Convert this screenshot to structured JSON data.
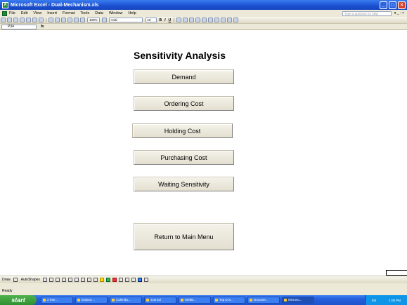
{
  "window": {
    "title": "Microsoft Excel - Dual-Mechanism.xls"
  },
  "menu": [
    "File",
    "Edit",
    "View",
    "Insert",
    "Format",
    "Tools",
    "Data",
    "Window",
    "Help"
  ],
  "help_placeholder": "Type a question for help",
  "toolbar": {
    "zoom": "100%",
    "font": "Arial",
    "font_size": "10",
    "bold": "B",
    "italic": "I",
    "underline": "U"
  },
  "formula": {
    "cell_ref": "P34",
    "fx_label": "fx"
  },
  "sheet": {
    "title": "Sensitivity Analysis",
    "buttons": [
      {
        "label": "Demand"
      },
      {
        "label": "Ordering Cost"
      },
      {
        "label": "Holding Cost"
      },
      {
        "label": "Purchasing Cost"
      },
      {
        "label": "Waiting Sensitivity"
      },
      {
        "label": "Return to Main Menu"
      }
    ]
  },
  "drawbar": {
    "draw_label": "Draw",
    "autoshapes_label": "AutoShapes"
  },
  "status": {
    "text": "Ready"
  },
  "taskbar": {
    "start_label": "start",
    "tasks": [
      "2 Inte...",
      "Eudora ...",
      "Calenda...",
      "Journal",
      "WebB...",
      "Top D.S...",
      "Docume...",
      "Microso..."
    ],
    "tray_lang": "EN",
    "time": "1:00 PM"
  }
}
